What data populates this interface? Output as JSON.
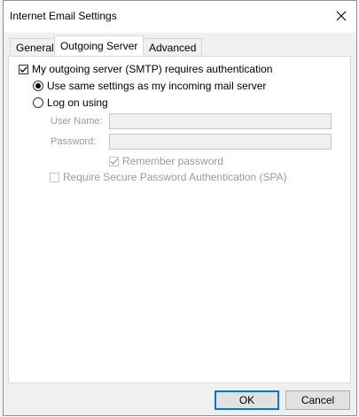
{
  "window": {
    "title": "Internet Email Settings"
  },
  "tabs": [
    {
      "label": "General"
    },
    {
      "label": "Outgoing Server"
    },
    {
      "label": "Advanced"
    }
  ],
  "outgoing": {
    "requires_auth_label": "My outgoing server (SMTP) requires authentication",
    "requires_auth_checked": true,
    "same_settings_label": "Use same settings as my incoming mail server",
    "same_settings_selected": true,
    "log_on_label": "Log on using",
    "log_on_selected": false,
    "username_label": "User Name:",
    "username_value": "",
    "password_label": "Password:",
    "password_value": "",
    "remember_label": "Remember password",
    "remember_checked": true,
    "spa_label": "Require Secure Password Authentication (SPA)",
    "spa_checked": false
  },
  "buttons": {
    "ok": "OK",
    "cancel": "Cancel"
  }
}
